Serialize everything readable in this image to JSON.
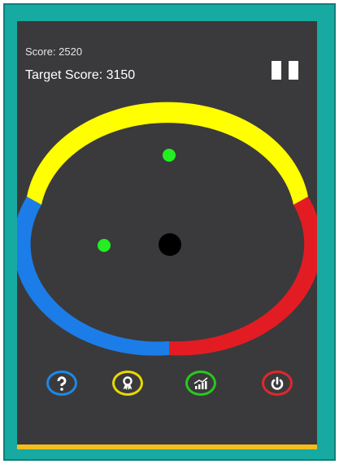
{
  "hud": {
    "score_text": "Score: 2520",
    "target_text": "Target Score: 3150"
  },
  "colors": {
    "frame": "#17aaa2",
    "screen": "#3a3a3c",
    "bottom_bar": "#f6be1c",
    "ring_yellow": "#ffff00",
    "ring_red": "#e31c23",
    "ring_blue": "#1c7de8",
    "ball_green": "#22ee22",
    "center_ball": "#000000"
  },
  "buttons": [
    {
      "name": "help",
      "icon": "question-icon"
    },
    {
      "name": "achievements",
      "icon": "award-ribbon-icon"
    },
    {
      "name": "stats",
      "icon": "bar-chart-icon"
    },
    {
      "name": "power",
      "icon": "power-icon"
    }
  ],
  "pause": {
    "icon": "pause-icon"
  }
}
